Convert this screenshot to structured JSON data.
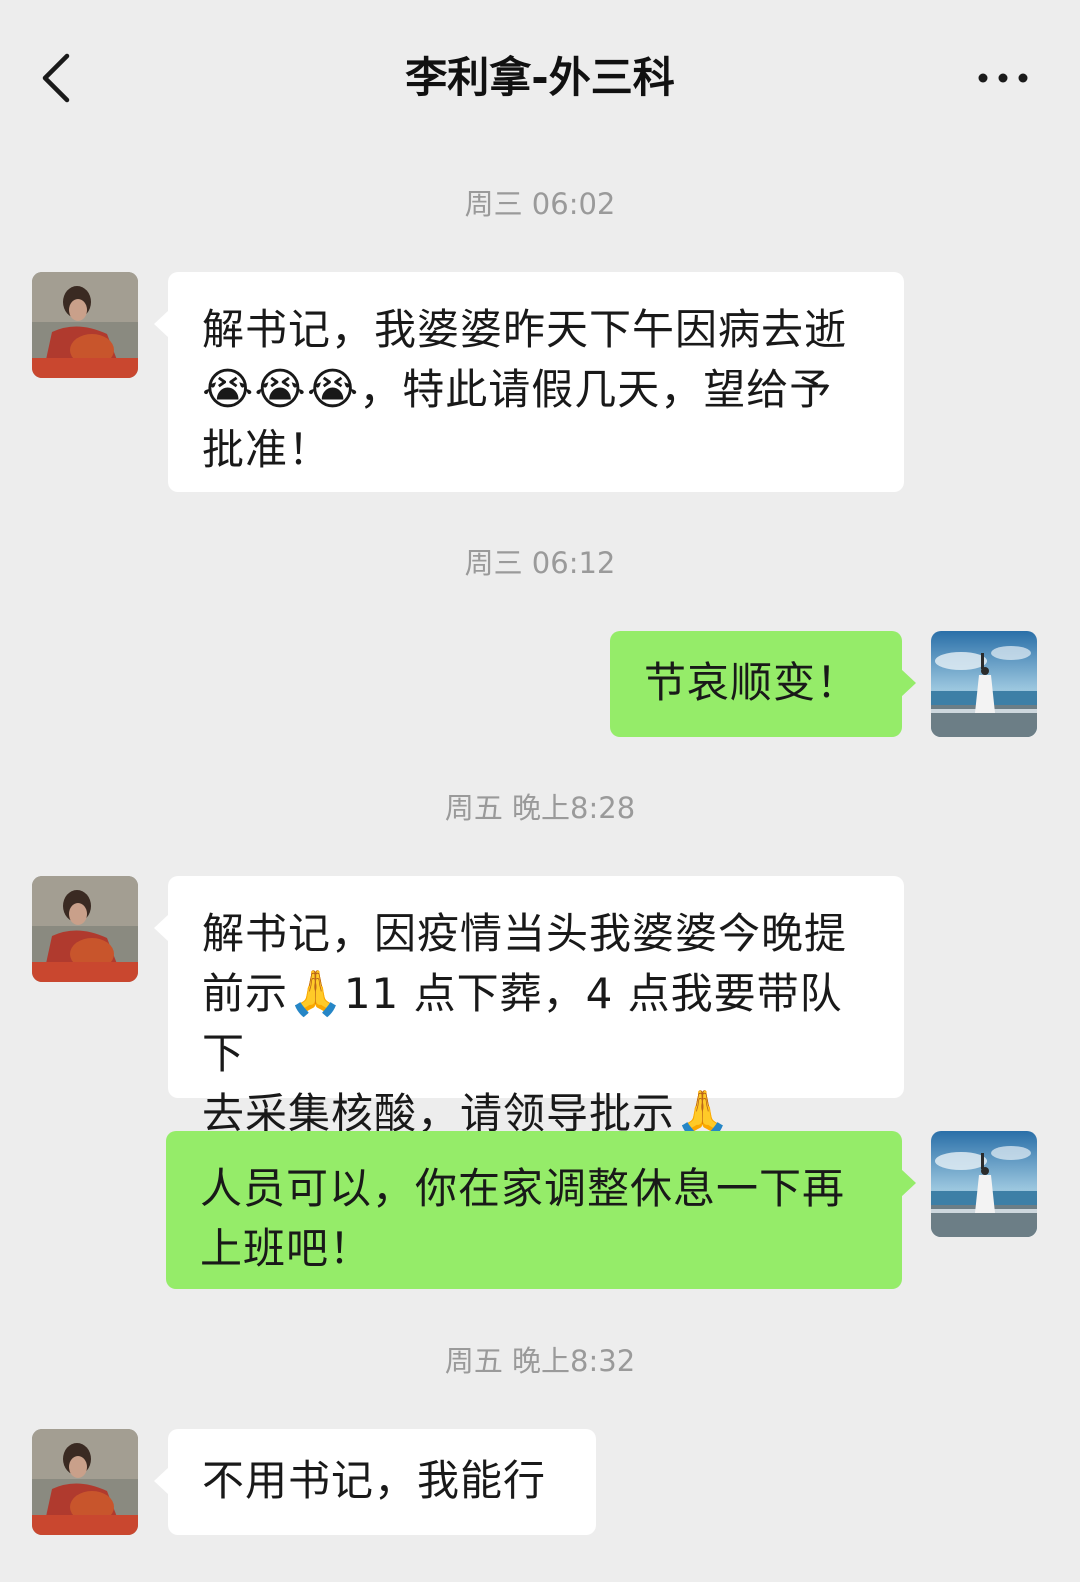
{
  "header": {
    "title": "李利拿-外三科",
    "back_icon": "chevron-left-icon",
    "more_icon": "more-dots-icon"
  },
  "timestamps": {
    "t1": "周三 06:02",
    "t2": "周三 06:12",
    "t3": "周五 晚上8:28",
    "t4": "周五 晚上8:32"
  },
  "messages": {
    "m1": {
      "line1": "解书记，我婆婆昨天下午因病去逝",
      "line2_emojis": "😭😭😭",
      "line2_text": "，特此请假几天，望给予",
      "line3": "批准！"
    },
    "m2": {
      "text": "节哀顺变！"
    },
    "m3": {
      "line1": "解书记，因疫情当头我婆婆今晚提",
      "line2_a": "前示",
      "line2_emoji": "🙏",
      "line2_b": "11 点下葬，4 点我要带队下",
      "line3_a": "去采集核酸，请领导批示",
      "line3_emoji": "🙏"
    },
    "m4": {
      "line1": "人员可以，你在家调整休息一下再",
      "line2": "上班吧！"
    },
    "m5": {
      "text": "不用书记，我能行"
    }
  },
  "colors": {
    "background": "#ededed",
    "bubble_incoming": "#ffffff",
    "bubble_outgoing": "#95ec69",
    "timestamp": "#9a9a9a"
  }
}
